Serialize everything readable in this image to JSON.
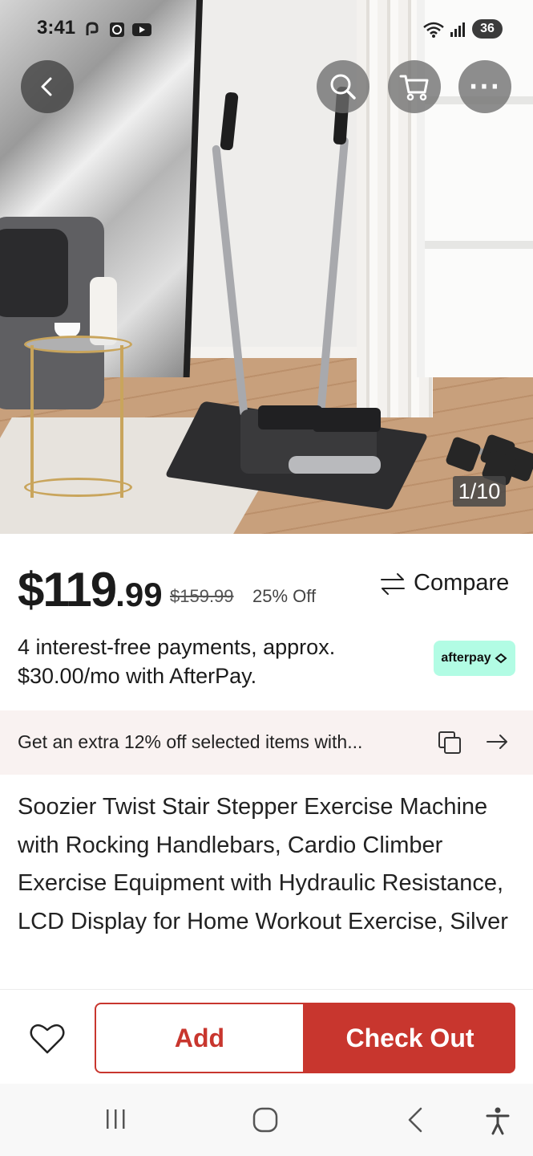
{
  "status_bar": {
    "time": "3:41",
    "battery": "36",
    "icons": [
      "notification-icon",
      "alarm-icon",
      "youtube-icon",
      "wifi-icon",
      "signal-icon",
      "battery-icon"
    ]
  },
  "top_nav": {
    "back_icon": "back-arrow-icon",
    "search_icon": "search-icon",
    "cart_icon": "cart-icon",
    "more_icon": "more-icon",
    "more_label": "···"
  },
  "gallery": {
    "counter": "1/10"
  },
  "price": {
    "currency_whole": "$119",
    "cents": ".99",
    "original": "$159.99",
    "discount": "25% Off"
  },
  "compare": {
    "label": "Compare",
    "icon": "compare-arrows-icon"
  },
  "afterpay": {
    "line1": "4 interest-free payments, approx.",
    "line2": "$30.00/mo with AfterPay.",
    "badge_label": "afterpay",
    "badge_color": "#b2fce4"
  },
  "promo": {
    "text": "Get an extra 12% off selected items with...",
    "copy_icon": "copy-icon",
    "arrow_icon": "arrow-right-icon"
  },
  "product": {
    "title": "Soozier Twist Stair Stepper Exercise Machine with Rocking Handlebars, Cardio Climber Exercise Equipment with Hydraulic Resistance, LCD Display for Home Workout Exercise, Silver"
  },
  "actions": {
    "wishlist_icon": "heart-icon",
    "add_label": "Add",
    "checkout_label": "Check Out",
    "accent_color": "#c8362e"
  },
  "system_nav": {
    "icons": [
      "recents-icon",
      "home-icon",
      "back-icon",
      "accessibility-icon"
    ]
  }
}
